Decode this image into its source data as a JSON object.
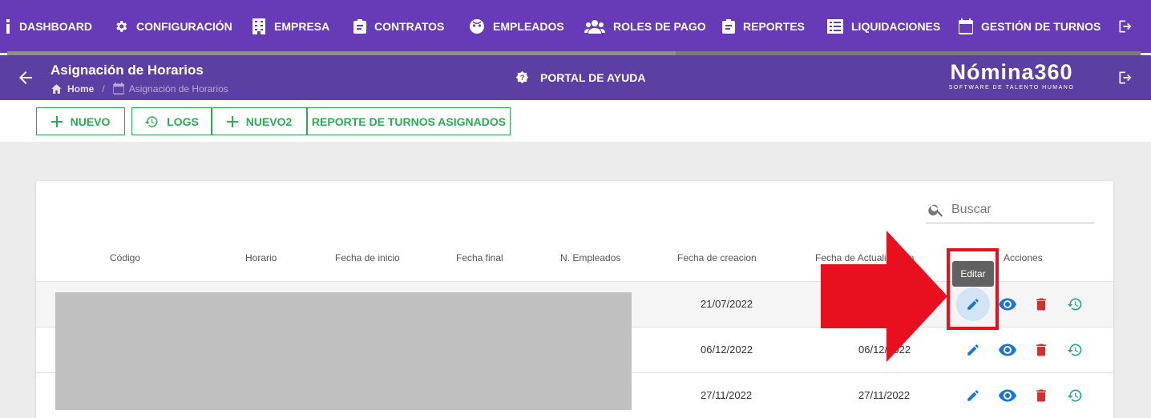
{
  "nav": {
    "items": [
      {
        "label": "DASHBOARD",
        "icon": "dashboard-icon"
      },
      {
        "label": "CONFIGURACIÓN",
        "icon": "gear-icon"
      },
      {
        "label": "EMPRESA",
        "icon": "building-icon"
      },
      {
        "label": "CONTRATOS",
        "icon": "clipboard-icon"
      },
      {
        "label": "EMPLEADOS",
        "icon": "face-icon"
      },
      {
        "label": "ROLES DE PAGO",
        "icon": "group-icon"
      },
      {
        "label": "REPORTES",
        "icon": "clipboard-icon"
      },
      {
        "label": "LIQUIDACIONES",
        "icon": "list-icon"
      },
      {
        "label": "GESTIÓN DE TURNOS",
        "icon": "calendar-icon"
      }
    ],
    "progress": 0.59
  },
  "header": {
    "title": "Asignación de Horarios",
    "breadcrumb": {
      "home": "Home",
      "current": "Asignación de Horarios"
    },
    "help": "PORTAL DE AYUDA",
    "logo": {
      "main": "Nómina360",
      "sub": "SOFTWARE DE TALENTO HUMANO"
    }
  },
  "toolbar": {
    "nuevo": "NUEVO",
    "logs": "LOGS",
    "nuevo2": "NUEVO2",
    "reporte": "REPORTE DE TURNOS ASIGNADOS"
  },
  "search": {
    "placeholder": "Buscar"
  },
  "table": {
    "columns": [
      "Código",
      "Horario",
      "Fecha de inicio",
      "Fecha final",
      "N. Empleados",
      "Fecha de creacion",
      "Fecha de Actualizacion",
      "Acciones"
    ],
    "rows": [
      {
        "creacion": "21/07/2022",
        "actualizacion": ""
      },
      {
        "creacion": "06/12/2022",
        "actualizacion": "06/12/2022"
      },
      {
        "creacion": "27/11/2022",
        "actualizacion": "27/11/2022"
      }
    ]
  },
  "tooltip": "Editar",
  "colors": {
    "nav": "#673ab7",
    "header": "#5c3fa3",
    "accent": "#2bab54",
    "edit": "#1976d2",
    "delete": "#d32f2f",
    "history": "#26a69a",
    "annotation": "#e8101f"
  }
}
